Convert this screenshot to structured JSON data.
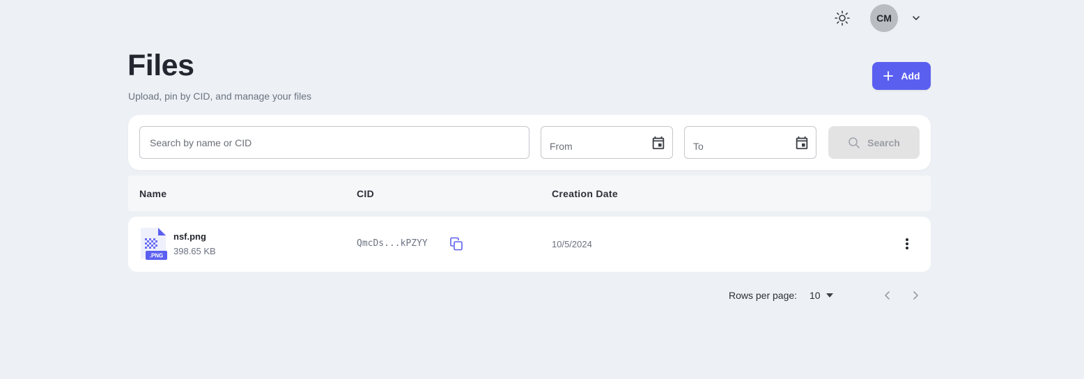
{
  "header": {
    "theme_icon": "sun-icon",
    "avatar_initials": "CM",
    "user_menu_icon": "chevron-down-icon"
  },
  "page": {
    "title": "Files",
    "subtitle": "Upload, pin by CID, and manage your files",
    "add_label": "Add",
    "add_icon": "plus-icon"
  },
  "filters": {
    "search_placeholder": "Search by name or CID",
    "from_label": "From",
    "to_label": "To",
    "calendar_icon": "calendar-icon",
    "search_label": "Search",
    "search_icon": "search-icon"
  },
  "table": {
    "columns": [
      "Name",
      "CID",
      "Creation Date"
    ],
    "rows": [
      {
        "name": "nsf.png",
        "size": "398.65 KB",
        "file_badge": ".PNG",
        "cid": "QmcDs...kPZYY",
        "created": "10/5/2024"
      }
    ]
  },
  "pagination": {
    "rows_per_page_label": "Rows per page:",
    "rows_per_page_value": "10"
  },
  "colors": {
    "background": "#edf1f5",
    "accent": "#5b5ff0",
    "card": "#ffffff",
    "muted_text": "#6b7280"
  }
}
